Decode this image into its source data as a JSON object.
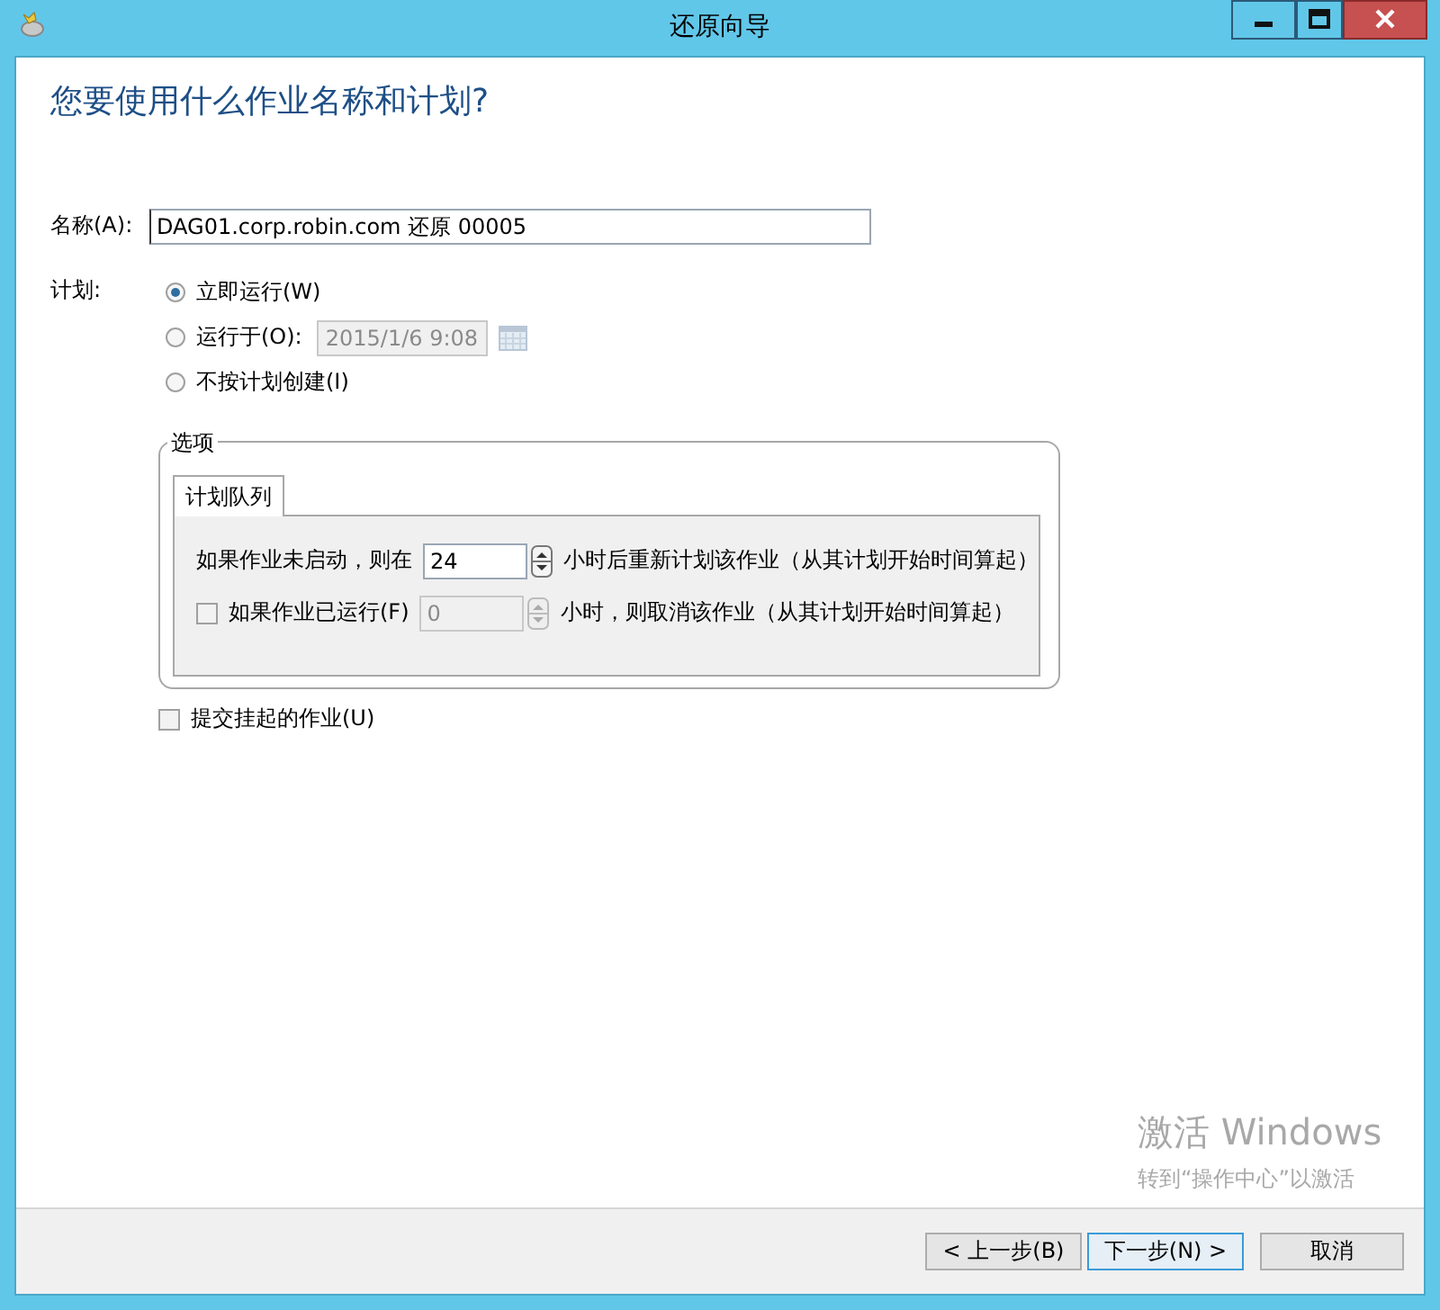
{
  "window": {
    "title": "还原向导"
  },
  "heading": "您要使用什么作业名称和计划?",
  "name_field": {
    "label": "名称(A):",
    "value": "DAG01.corp.robin.com 还原 00005"
  },
  "schedule": {
    "label": "计划:",
    "options": [
      {
        "label": "立即运行(W)",
        "selected": true
      },
      {
        "label": "运行于(O):",
        "selected": false,
        "date": {
          "value": "2015/1/6 9:08",
          "disabled": true
        }
      },
      {
        "label": "不按计划创建(I)",
        "selected": false
      }
    ]
  },
  "options_group": {
    "title": "选项",
    "tabs": [
      {
        "label": "计划队列",
        "selected": true
      }
    ],
    "rows": [
      {
        "kind": "text",
        "label": "如果作业未启动，则在",
        "value": "24",
        "suffix": "小时后重新计划该作业（从其计划开始时间算起）",
        "disabled": false
      },
      {
        "kind": "checkbox",
        "label": "如果作业已运行(F)",
        "checked": false,
        "value": "0",
        "suffix": "小时，则取消该作业（从其计划开始时间算起）",
        "disabled": true
      }
    ]
  },
  "submit_suspended": {
    "label": "提交挂起的作业(U)",
    "checked": false
  },
  "buttons": [
    {
      "label": "< 上一步(B)",
      "default": false
    },
    {
      "label": "下一步(N) >",
      "default": true
    },
    {
      "label": "取消",
      "default": false
    }
  ],
  "activation": {
    "title": "激活 Windows",
    "hint": "转到“操作中心”以激活"
  }
}
